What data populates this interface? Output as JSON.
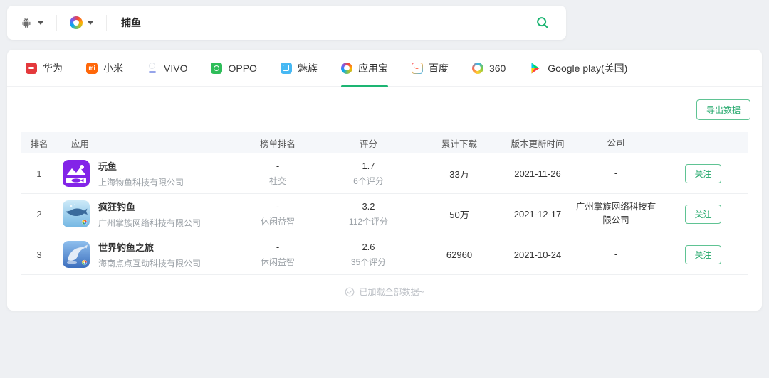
{
  "colors": {
    "accent": "#1db573",
    "page_bg": "#eef0f3"
  },
  "search_bar": {
    "query": "捕鱼",
    "icons": {
      "platform": "android-icon",
      "store": "yingyongbao-swirl-icon",
      "search": "search-icon",
      "dropdown": "chevron-down-icon"
    }
  },
  "tabs": [
    {
      "label": "华为",
      "icon": "huawei-appstore-icon",
      "selected": false
    },
    {
      "label": "小米",
      "icon": "xiaomi-appstore-icon",
      "selected": false
    },
    {
      "label": "VIVO",
      "icon": "vivo-appstore-icon",
      "selected": false
    },
    {
      "label": "OPPO",
      "icon": "oppo-appstore-icon",
      "selected": false
    },
    {
      "label": "魅族",
      "icon": "meizu-appstore-icon",
      "selected": false
    },
    {
      "label": "应用宝",
      "icon": "yingyongbao-swirl-icon",
      "selected": true
    },
    {
      "label": "百度",
      "icon": "baidu-appstore-icon",
      "selected": false
    },
    {
      "label": "360",
      "icon": "360-appstore-icon",
      "selected": false
    },
    {
      "label": "Google play(美国)",
      "icon": "google-play-icon",
      "selected": false
    }
  ],
  "toolbar": {
    "export_label": "导出数据"
  },
  "table": {
    "headers": {
      "rank": "排名",
      "app": "应用",
      "list_rank": "榜单排名",
      "rating": "评分",
      "downloads": "累计下载",
      "updated": "版本更新时间",
      "company": "公司"
    },
    "rows": [
      {
        "rank": "1",
        "app_name": "玩鱼",
        "app_company": "上海物鱼科技有限公司",
        "list_rank": "-",
        "category": "社交",
        "rating": "1.7",
        "rating_count": "6个评分",
        "downloads": "33万",
        "updated": "2021-11-26",
        "company": "-",
        "action": "关注"
      },
      {
        "rank": "2",
        "app_name": "疯狂钓鱼",
        "app_company": "广州掌族网络科技有限公司",
        "list_rank": "-",
        "category": "休闲益智",
        "rating": "3.2",
        "rating_count": "112个评分",
        "downloads": "50万",
        "updated": "2021-12-17",
        "company": "广州掌族网络科技有限公司",
        "action": "关注"
      },
      {
        "rank": "3",
        "app_name": "世界钓鱼之旅",
        "app_company": "海南点点互动科技有限公司",
        "list_rank": "-",
        "category": "休闲益智",
        "rating": "2.6",
        "rating_count": "35个评分",
        "downloads": "62960",
        "updated": "2021-10-24",
        "company": "-",
        "action": "关注"
      }
    ]
  },
  "footer": {
    "loaded_text": "已加载全部数据~",
    "icon": "check-circle-icon"
  }
}
